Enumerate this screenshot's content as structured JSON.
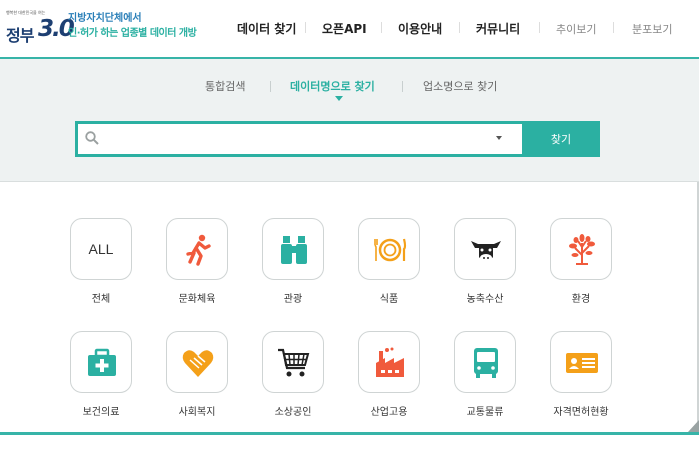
{
  "logo": {
    "small_text": "행복한 대한민국을 여는",
    "word": "정부",
    "version": "3.0",
    "line1": "지방자치단체에서",
    "line2": "인·허가 하는 업종별 데이터 개방"
  },
  "nav": {
    "items": [
      "데이터 찾기",
      "오픈API",
      "이용안내",
      "커뮤니티"
    ],
    "light_items": [
      "추이보기",
      "분포보기"
    ]
  },
  "search": {
    "tabs": [
      "통합검색",
      "데이터명으로 찾기",
      "업소명으로 찾기"
    ],
    "active_tab": 1,
    "placeholder": "",
    "button_label": "찾기"
  },
  "categories": [
    {
      "label": "전체",
      "icon": "all-text",
      "text": "ALL"
    },
    {
      "label": "문화체육",
      "icon": "running-person-icon",
      "color": "#f05a3c"
    },
    {
      "label": "관광",
      "icon": "binoculars-icon",
      "color": "#2bb0a2"
    },
    {
      "label": "식품",
      "icon": "plate-fork-knife-icon",
      "color": "#f4a019"
    },
    {
      "label": "농축수산",
      "icon": "cow-head-icon",
      "color": "#222222"
    },
    {
      "label": "환경",
      "icon": "tree-icon",
      "color": "#f05a3c"
    },
    {
      "label": "보건의료",
      "icon": "first-aid-kit-icon",
      "color": "#2bb0a2"
    },
    {
      "label": "사회복지",
      "icon": "heart-hands-icon",
      "color": "#f4a019"
    },
    {
      "label": "소상공인",
      "icon": "shopping-cart-icon",
      "color": "#222222"
    },
    {
      "label": "산업고용",
      "icon": "factory-icon",
      "color": "#f05a3c"
    },
    {
      "label": "교통물류",
      "icon": "bus-icon",
      "color": "#2bb0a2"
    },
    {
      "label": "자격면허현황",
      "icon": "id-card-icon",
      "color": "#f4a019"
    }
  ],
  "colors": {
    "accent": "#2bb0a2",
    "band": "#eef2f2"
  }
}
